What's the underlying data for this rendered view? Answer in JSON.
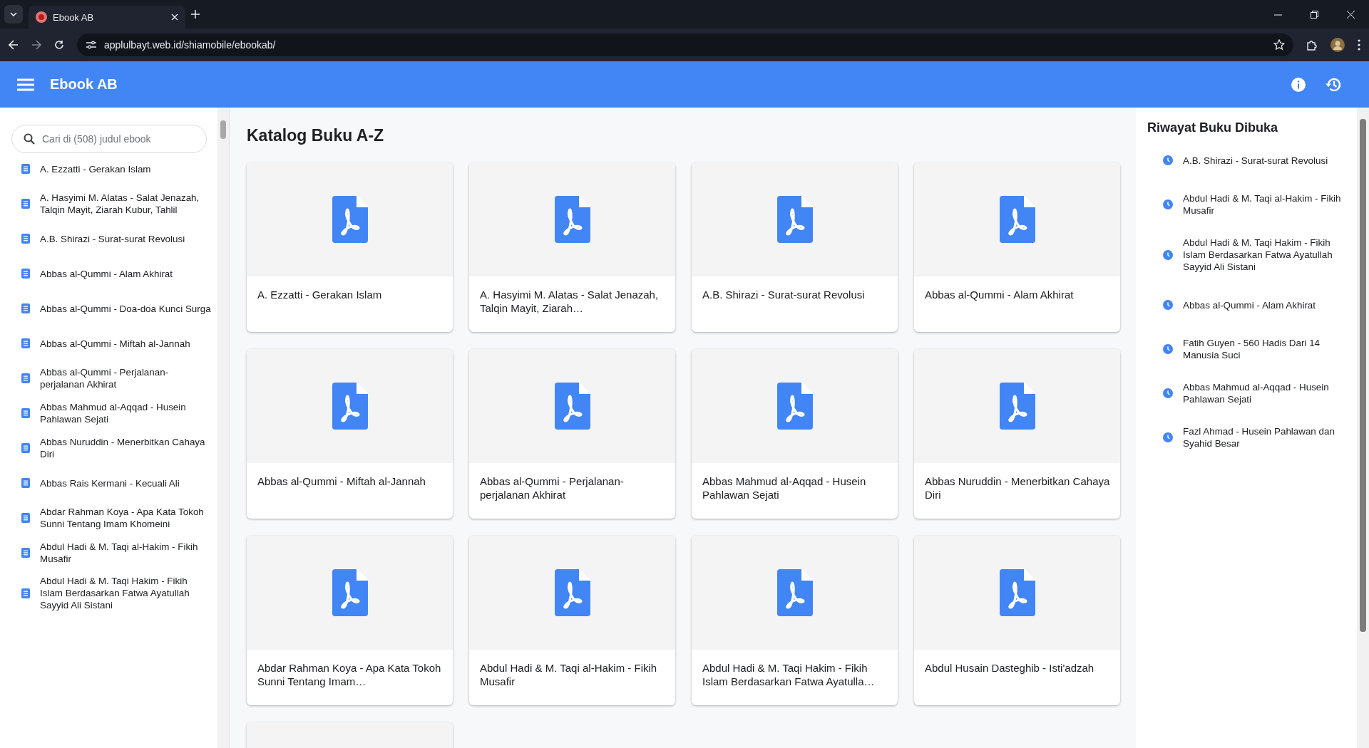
{
  "browser": {
    "tab_title": "Ebook AB",
    "url": "applulbayt.web.id/shiamobile/ebookab/"
  },
  "app_bar": {
    "title": "Ebook AB"
  },
  "sidebar": {
    "search": {
      "placeholder": "Cari di (508) judul ebook"
    },
    "items": [
      {
        "label": "A. Ezzatti - Gerakan Islam"
      },
      {
        "label": "A. Hasyimi M. Alatas - Salat Jenazah, Talqin Mayit, Ziarah Kubur, Tahlil"
      },
      {
        "label": "A.B. Shirazi - Surat-surat Revolusi"
      },
      {
        "label": "Abbas al-Qummi - Alam Akhirat"
      },
      {
        "label": "Abbas al-Qummi - Doa-doa Kunci Surga"
      },
      {
        "label": "Abbas al-Qummi - Miftah al-Jannah"
      },
      {
        "label": "Abbas al-Qummi - Perjalanan-perjalanan Akhirat"
      },
      {
        "label": "Abbas Mahmud al-Aqqad - Husein Pahlawan Sejati"
      },
      {
        "label": "Abbas Nuruddin - Menerbitkan Cahaya Diri"
      },
      {
        "label": "Abbas Rais Kermani - Kecuali Ali"
      },
      {
        "label": "Abdar Rahman Koya - Apa Kata Tokoh Sunni Tentang Imam Khomeini"
      },
      {
        "label": "Abdul Hadi & M. Taqi al-Hakim - Fikih Musafir"
      },
      {
        "label": "Abdul Hadi & M. Taqi Hakim - Fikih Islam Berdasarkan Fatwa Ayatullah Sayyid Ali Sistani"
      }
    ]
  },
  "catalog": {
    "heading": "Katalog Buku A-Z",
    "cards": [
      {
        "title": "A. Ezzatti - Gerakan Islam"
      },
      {
        "title": "A. Hasyimi M. Alatas - Salat Jenazah, Talqin Mayit, Ziarah…"
      },
      {
        "title": "A.B. Shirazi - Surat-surat Revolusi"
      },
      {
        "title": "Abbas al-Qummi - Alam Akhirat"
      },
      {
        "title": "Abbas al-Qummi - Miftah al-Jannah"
      },
      {
        "title": "Abbas al-Qummi - Perjalanan-perjalanan Akhirat"
      },
      {
        "title": "Abbas Mahmud al-Aqqad - Husein Pahlawan Sejati"
      },
      {
        "title": "Abbas Nuruddin - Menerbitkan Cahaya Diri"
      },
      {
        "title": "Abdar Rahman Koya - Apa Kata Tokoh Sunni Tentang Imam…"
      },
      {
        "title": "Abdul Hadi & M. Taqi al-Hakim - Fikih Musafir"
      },
      {
        "title": "Abdul Hadi & M. Taqi Hakim - Fikih Islam Berdasarkan Fatwa Ayatulla…"
      },
      {
        "title": "Abdul Husain Dasteghib - Isti'adzah"
      }
    ],
    "cut_off_card_below": true
  },
  "history": {
    "heading": "Riwayat Buku Dibuka",
    "items": [
      {
        "label": "A.B. Shirazi - Surat-surat Revolusi"
      },
      {
        "label": "Abdul Hadi & M. Taqi al-Hakim - Fikih Musafir"
      },
      {
        "label": "Abdul Hadi & M. Taqi Hakim - Fikih Islam Berdasarkan Fatwa Ayatullah Sayyid Ali Sistani"
      },
      {
        "label": "Abbas al-Qummi - Alam Akhirat"
      },
      {
        "label": "Fatih Guyen - 560 Hadis Dari 14 Manusia Suci"
      },
      {
        "label": "Abbas Mahmud al-Aqqad - Husein Pahlawan Sejati"
      },
      {
        "label": "Fazl Ahmad - Husein Pahlawan dan Syahid Besar"
      }
    ]
  }
}
